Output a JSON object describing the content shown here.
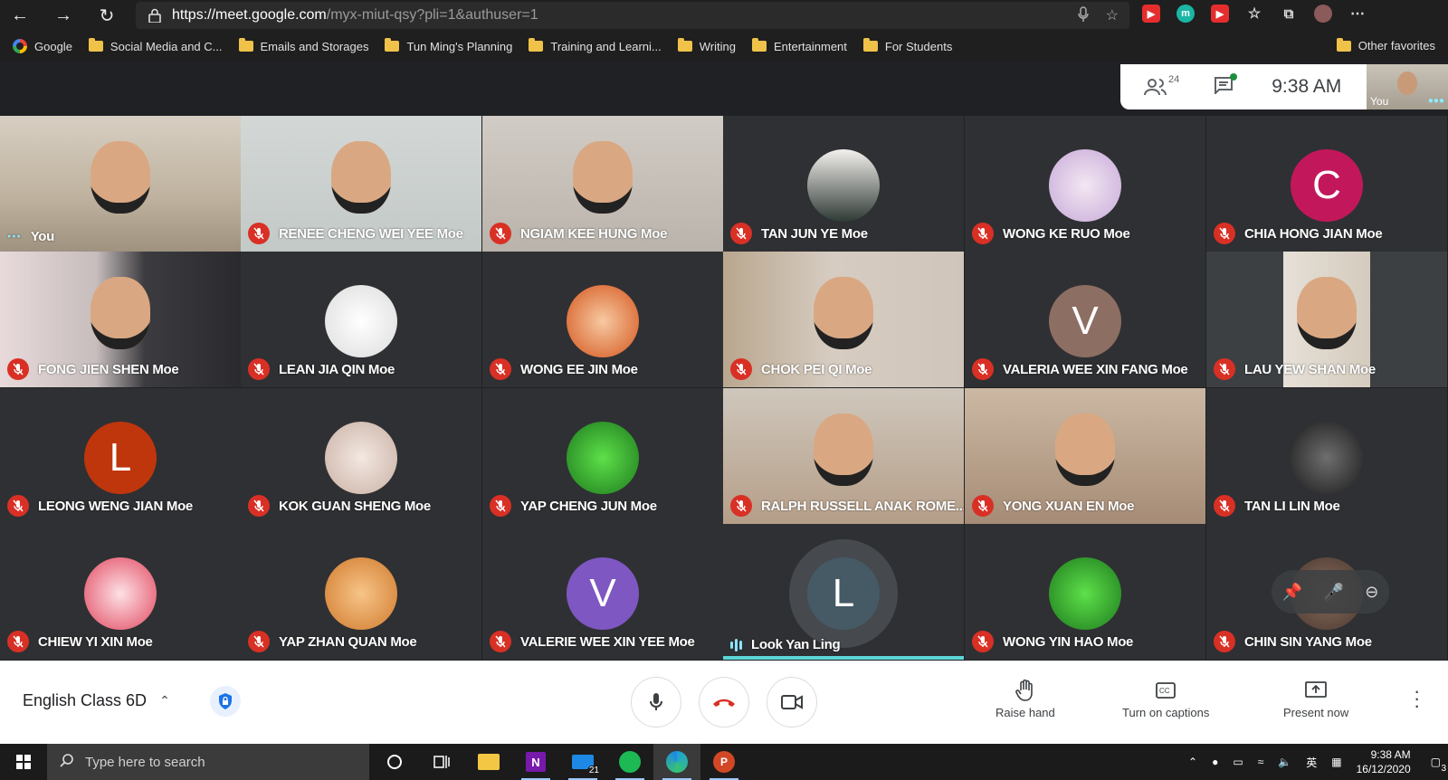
{
  "browser": {
    "url_host": "https://meet.google.com",
    "url_path": "/myx-miut-qsy?pli=1&authuser=1",
    "bookmarks": [
      {
        "label": "Google",
        "icon": "google-icon"
      },
      {
        "label": "Social Media and C...",
        "icon": "folder-icon"
      },
      {
        "label": "Emails and Storages",
        "icon": "folder-icon"
      },
      {
        "label": "Tun Ming's Planning",
        "icon": "folder-icon"
      },
      {
        "label": "Training and Learni...",
        "icon": "folder-icon"
      },
      {
        "label": "Writing",
        "icon": "folder-icon"
      },
      {
        "label": "Entertainment",
        "icon": "folder-icon"
      },
      {
        "label": "For Students",
        "icon": "folder-icon"
      }
    ],
    "other_favorites": "Other favorites"
  },
  "meet": {
    "participant_count": "24",
    "time": "9:38 AM",
    "self_label": "You",
    "meeting_name": "English Class 6D",
    "actions": {
      "raise_hand": "Raise hand",
      "captions": "Turn on captions",
      "present": "Present now"
    },
    "colors": {
      "mute_red": "#d93025",
      "speaking_cyan": "#5cd6d6"
    },
    "participants": [
      {
        "name": "You",
        "type": "video",
        "status": "self"
      },
      {
        "name": "RENEE CHENG WEI YEE Moe",
        "type": "video",
        "status": "muted"
      },
      {
        "name": "NGIAM KEE HUNG Moe",
        "type": "video",
        "status": "muted"
      },
      {
        "name": "TAN JUN YE Moe",
        "type": "avatar",
        "status": "muted"
      },
      {
        "name": "WONG KE RUO Moe",
        "type": "avatar",
        "status": "muted"
      },
      {
        "name": "CHIA HONG JIAN Moe",
        "type": "letter",
        "letter": "C",
        "color": "#c2185b",
        "status": "muted"
      },
      {
        "name": "FONG JIEN SHEN Moe",
        "type": "video",
        "status": "muted"
      },
      {
        "name": "LEAN JIA QIN Moe",
        "type": "avatar",
        "status": "muted"
      },
      {
        "name": "WONG EE JIN Moe",
        "type": "avatar",
        "status": "muted"
      },
      {
        "name": "CHOK PEI QI Moe",
        "type": "video",
        "status": "muted"
      },
      {
        "name": "VALERIA WEE XIN FANG Moe",
        "type": "letter",
        "letter": "V",
        "color": "#8d6e63",
        "status": "muted"
      },
      {
        "name": "LAU YEW SHAN Moe",
        "type": "video",
        "status": "muted"
      },
      {
        "name": "LEONG WENG JIAN Moe",
        "type": "letter",
        "letter": "L",
        "color": "#bf360c",
        "status": "muted"
      },
      {
        "name": "KOK GUAN SHENG Moe",
        "type": "avatar",
        "status": "muted"
      },
      {
        "name": "YAP CHENG JUN Moe",
        "type": "avatar",
        "status": "muted"
      },
      {
        "name": "RALPH RUSSELL ANAK ROME...",
        "type": "video",
        "status": "muted"
      },
      {
        "name": "YONG XUAN EN Moe",
        "type": "video",
        "status": "muted"
      },
      {
        "name": "TAN LI LIN Moe",
        "type": "avatar",
        "status": "muted"
      },
      {
        "name": "CHIEW YI XIN Moe",
        "type": "avatar",
        "status": "muted"
      },
      {
        "name": "YAP ZHAN QUAN Moe",
        "type": "avatar",
        "status": "muted"
      },
      {
        "name": "VALERIE WEE XIN YEE Moe",
        "type": "letter",
        "letter": "V",
        "color": "#7e57c2",
        "status": "muted"
      },
      {
        "name": "Look Yan Ling",
        "type": "letter",
        "letter": "L",
        "color": "#455a64",
        "status": "speaking"
      },
      {
        "name": "WONG YIN HAO Moe",
        "type": "avatar",
        "status": "muted"
      },
      {
        "name": "CHIN SIN YANG Moe",
        "type": "avatar",
        "status": "muted"
      }
    ]
  },
  "taskbar": {
    "search_placeholder": "Type here to search",
    "mail_badge": "21",
    "ime": "英",
    "time": "9:38 AM",
    "date": "16/12/2020",
    "notifications": "3"
  }
}
